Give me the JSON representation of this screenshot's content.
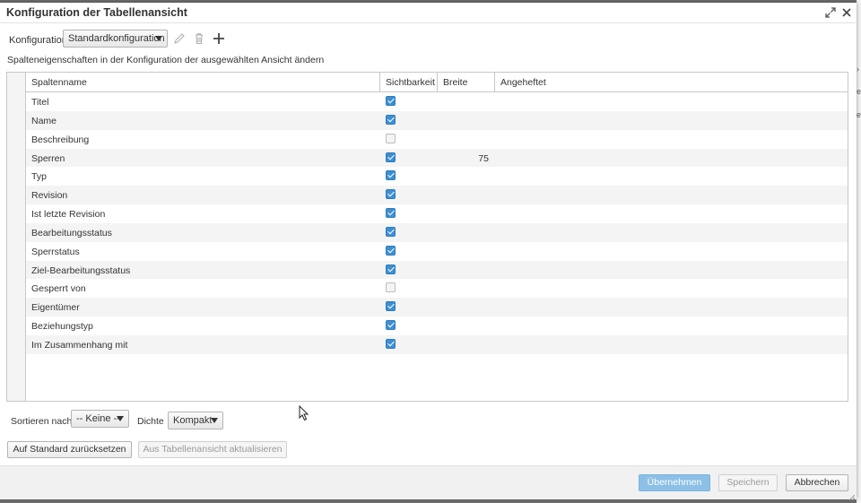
{
  "dialog": {
    "title": "Konfiguration der Tabellenansicht",
    "maximize_icon": "maximize-icon",
    "close_icon": "close-icon"
  },
  "config": {
    "label": "Konfiguration",
    "selected": "Standardkonfiguration",
    "actions": [
      "edit-icon",
      "delete-icon",
      "add-icon"
    ]
  },
  "description": "Spalteneigenschaften in der Konfiguration der ausgewählten Ansicht ändern",
  "grid": {
    "columns": [
      "Spaltenname",
      "Sichtbarkeit",
      "Breite",
      "Angeheftet"
    ],
    "rows": [
      {
        "name": "Titel",
        "visible": true,
        "width": ""
      },
      {
        "name": "Name",
        "visible": true,
        "width": ""
      },
      {
        "name": "Beschreibung",
        "visible": false,
        "width": ""
      },
      {
        "name": "Sperren",
        "visible": true,
        "width": "75"
      },
      {
        "name": "Typ",
        "visible": true,
        "width": ""
      },
      {
        "name": "Revision",
        "visible": true,
        "width": ""
      },
      {
        "name": "Ist letzte Revision",
        "visible": true,
        "width": ""
      },
      {
        "name": "Bearbeitungsstatus",
        "visible": true,
        "width": ""
      },
      {
        "name": "Sperrstatus",
        "visible": true,
        "width": ""
      },
      {
        "name": "Ziel-Bearbeitungsstatus",
        "visible": true,
        "width": ""
      },
      {
        "name": "Gesperrt von",
        "visible": false,
        "width": ""
      },
      {
        "name": "Eigentümer",
        "visible": true,
        "width": ""
      },
      {
        "name": "Beziehungstyp",
        "visible": true,
        "width": ""
      },
      {
        "name": "Im Zusammenhang mit",
        "visible": true,
        "width": ""
      }
    ]
  },
  "sort": {
    "label": "Sortieren nach",
    "selected": "-- Keine --"
  },
  "density": {
    "label": "Dichte",
    "selected": "Kompakt"
  },
  "actions": {
    "reset": "Auf Standard zurücksetzen",
    "update_from_view": "Aus Tabellenansicht aktualisieren"
  },
  "footer": {
    "apply": "Übernehmen",
    "save": "Speichern",
    "cancel": "Abbrechen"
  },
  "colors": {
    "accent": "#3d8fd3",
    "primary_disabled": "#8cc0e6",
    "overlay": "#6d6d6d"
  }
}
